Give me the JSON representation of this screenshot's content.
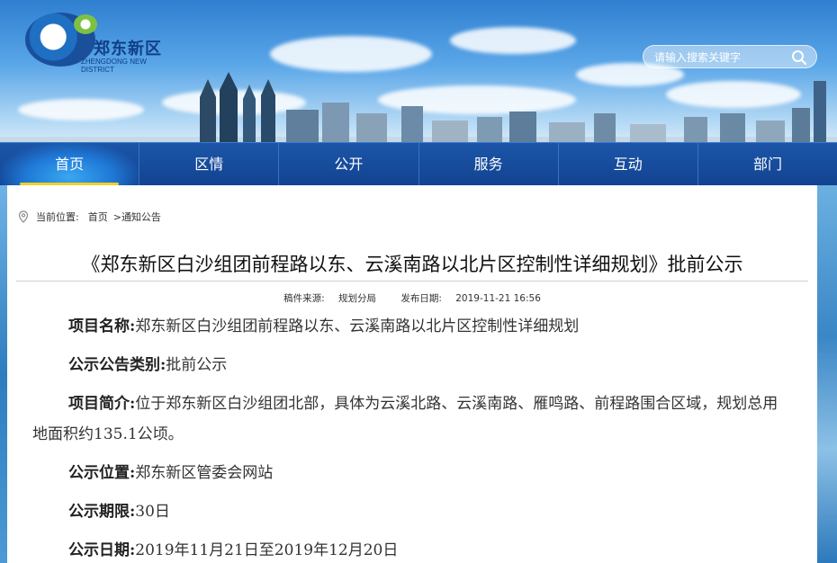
{
  "header": {
    "logo_text": "郑东新区",
    "logo_sub": "ZHENGDONG NEW DISTRICT",
    "search_placeholder": "请输入搜索关键字"
  },
  "nav": {
    "items": [
      {
        "label": "首页",
        "active": true
      },
      {
        "label": "区情",
        "active": false
      },
      {
        "label": "公开",
        "active": false
      },
      {
        "label": "服务",
        "active": false
      },
      {
        "label": "互动",
        "active": false
      },
      {
        "label": "部门",
        "active": false
      }
    ]
  },
  "breadcrumb": {
    "prefix": "当前位置:",
    "home": "首页",
    "sep": ">",
    "current": "通知公告"
  },
  "article": {
    "title": "《郑东新区白沙组团前程路以东、云溪南路以北片区控制性详细规划》批前公示",
    "source_label": "稿件来源:",
    "source": "规划分局",
    "date_label": "发布日期:",
    "date": "2019-11-21 16:56",
    "fields": [
      {
        "label": "项目名称:",
        "value": "郑东新区白沙组团前程路以东、云溪南路以北片区控制性详细规划"
      },
      {
        "label": "公示公告类别:",
        "value": "批前公示"
      },
      {
        "label": "项目简介:",
        "value": "位于郑东新区白沙组团北部，具体为云溪北路、云溪南路、雁鸣路、前程路围合区域，规划总用地面积约135.1公顷。"
      },
      {
        "label": "公示位置:",
        "value": "郑东新区管委会网站"
      },
      {
        "label": "公示期限:",
        "value": "30日"
      },
      {
        "label": "公示日期:",
        "value": "2019年11月21日至2019年12月20日"
      }
    ]
  },
  "colors": {
    "nav_bg": "#124391",
    "nav_active_underline": "#f0d02a",
    "logo_blue": "#0f3f86",
    "logo_green": "#7cc142"
  }
}
